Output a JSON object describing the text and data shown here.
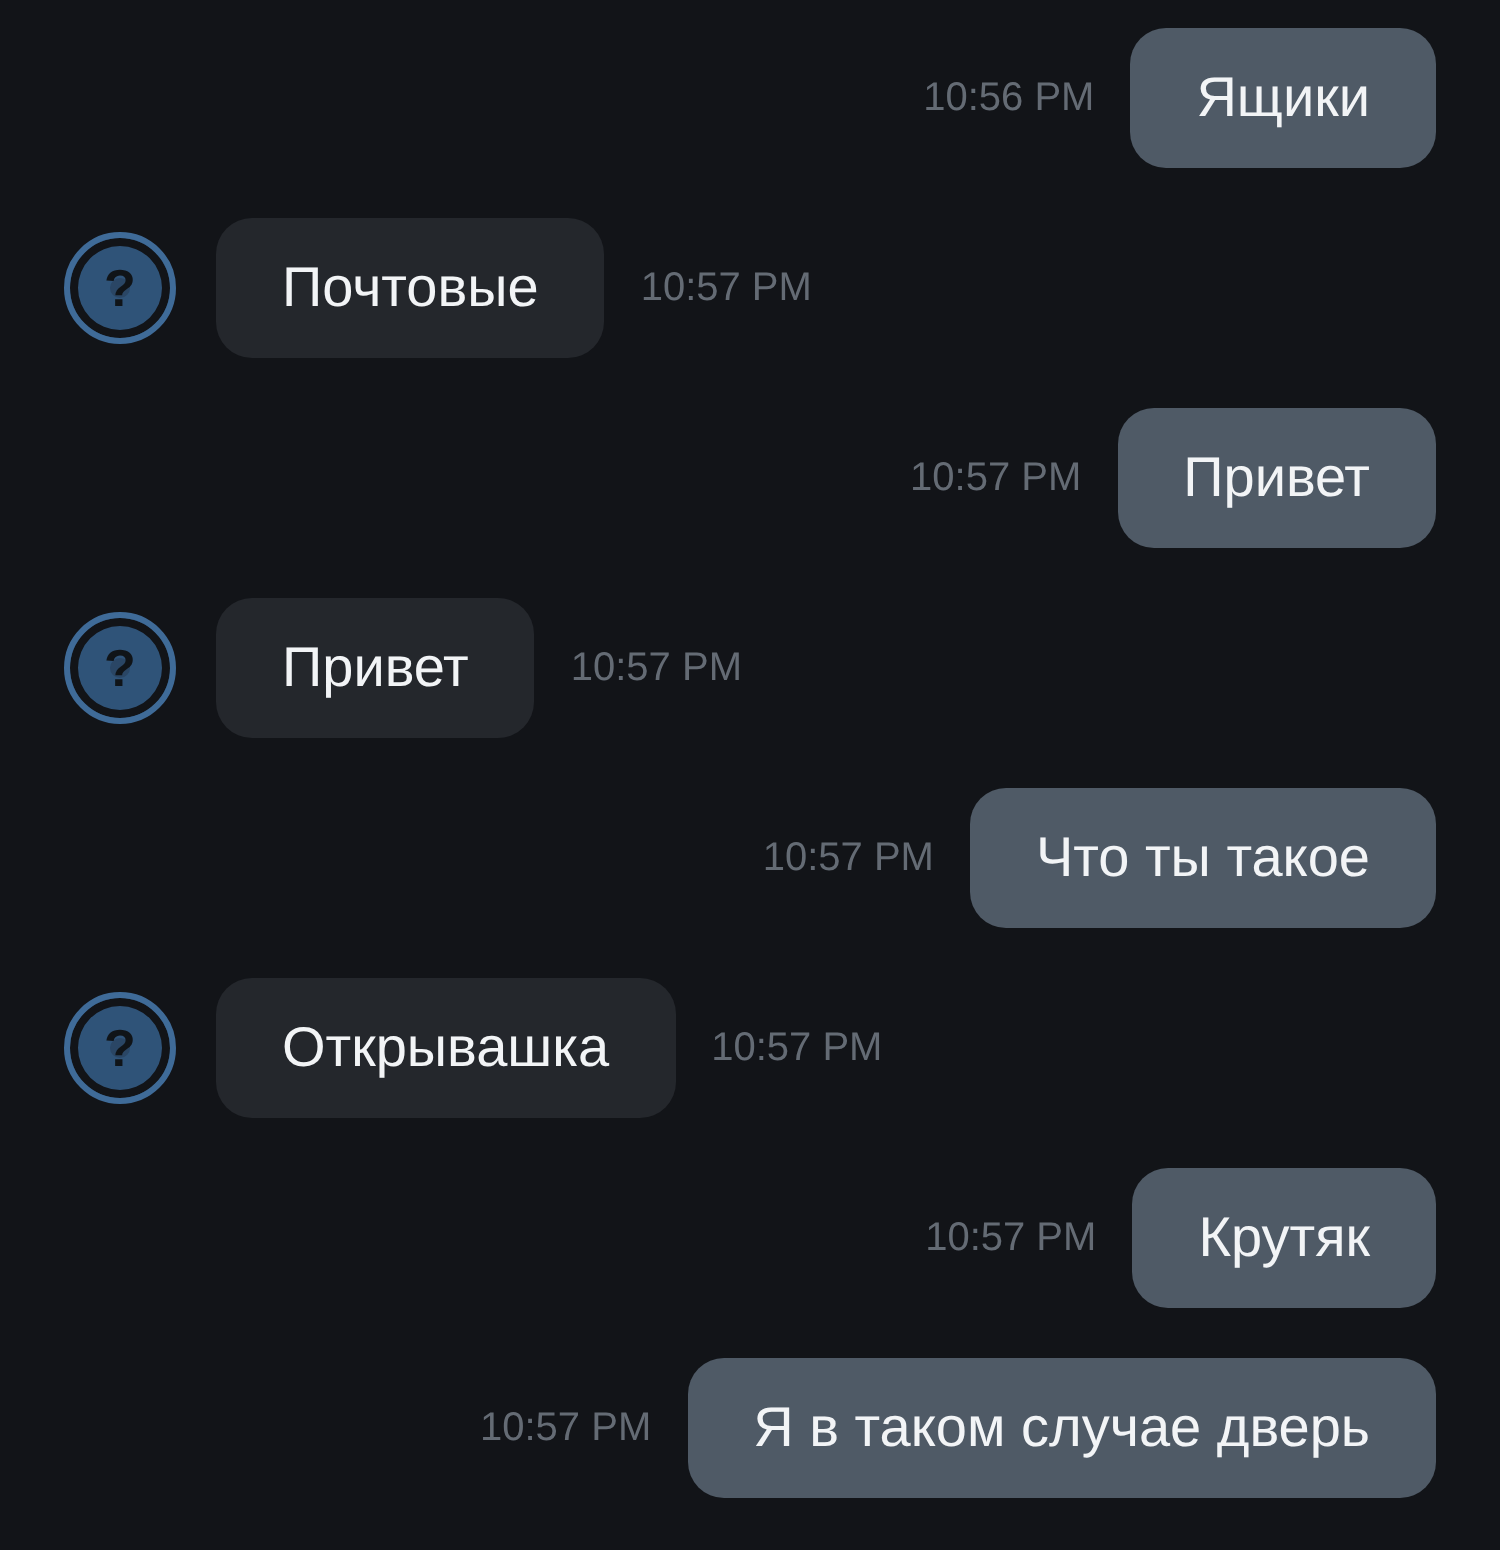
{
  "messages": [
    {
      "kind": "outgoing",
      "text": "Ящики",
      "time": "10:56 PM"
    },
    {
      "kind": "incoming",
      "text": "Почтовые",
      "time": "10:57 PM",
      "avatar": "?"
    },
    {
      "kind": "outgoing",
      "text": "Привет",
      "time": "10:57 PM"
    },
    {
      "kind": "incoming",
      "text": "Привет",
      "time": "10:57 PM",
      "avatar": "?"
    },
    {
      "kind": "outgoing",
      "text": "Что ты такое",
      "time": "10:57 PM"
    },
    {
      "kind": "incoming",
      "text": "Открывашка",
      "time": "10:57 PM",
      "avatar": "?"
    },
    {
      "kind": "outgoing",
      "text": "Крутяк",
      "time": "10:57 PM"
    },
    {
      "kind": "outgoing",
      "text": "Я в таком случае дверь",
      "time": "10:57 PM"
    }
  ]
}
